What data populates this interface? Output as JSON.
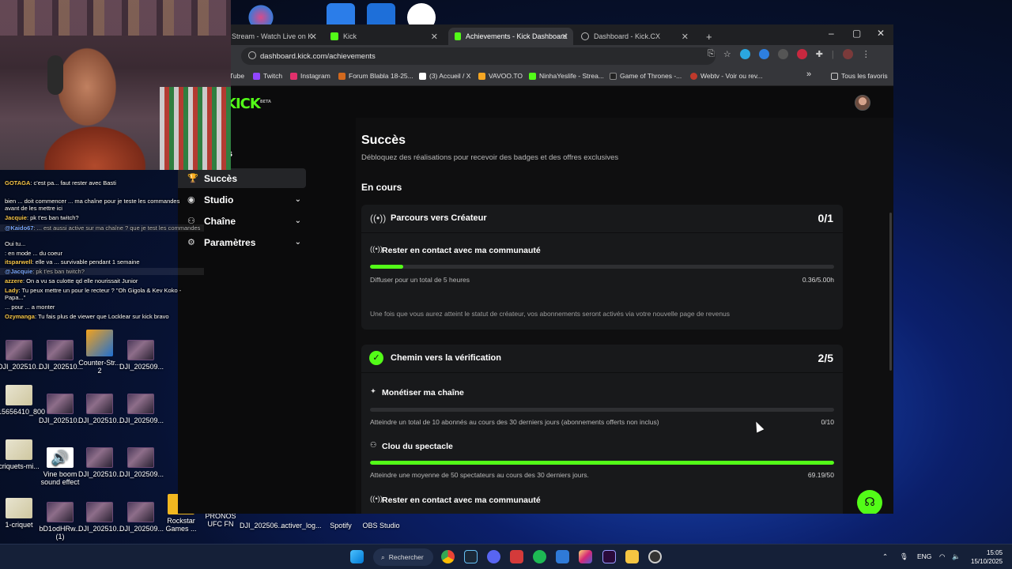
{
  "browser": {
    "tabs": [
      {
        "title": "Stream - Watch Live on K",
        "active": false
      },
      {
        "title": "Kick",
        "active": false
      },
      {
        "title": "Achievements - Kick Dashboard",
        "active": true
      },
      {
        "title": "Dashboard - Kick.CX",
        "active": false
      }
    ],
    "new_tab": "+",
    "url": "dashboard.kick.com/achievements",
    "bookmarks": [
      "Tube",
      "Twitch",
      "Instagram",
      "Forum Blabla 18-25...",
      "(3) Accueil / X",
      "VAVOO.TO",
      "NinhaYeslife - Strea...",
      "Game of Thrones -...",
      "Webtv - Voir ou rev..."
    ],
    "bookmarks_more": "»",
    "all_bookmarks": "Tous les favoris"
  },
  "kick": {
    "logo": "KICK",
    "logo_badge": "BETA",
    "sidebar": {
      "partial_items": [
        "n",
        "us"
      ],
      "items": [
        {
          "label": "Succès",
          "icon": "trophy-icon",
          "active": true,
          "expandable": false
        },
        {
          "label": "Studio",
          "icon": "studio-icon",
          "active": false,
          "expandable": true
        },
        {
          "label": "Chaîne",
          "icon": "channel-icon",
          "active": false,
          "expandable": true
        },
        {
          "label": "Paramètres",
          "icon": "settings-icon",
          "active": false,
          "expandable": true
        }
      ]
    },
    "main": {
      "title": "Succès",
      "subtitle": "Débloquez des réalisations pour recevoir des badges et des offres exclusives",
      "section": "En cours",
      "cards": [
        {
          "title": "Parcours vers Créateur",
          "count": "0/1",
          "tasks": [
            {
              "title": "Rester en contact avec ma communauté",
              "desc": "Diffuser pour un total de 5 heures",
              "value": "0.36/5.00h",
              "progress": 0.072
            }
          ],
          "note": "Une fois que vous aurez atteint le statut de créateur, vos abonnements seront activés via votre nouvelle page de revenus"
        },
        {
          "title": "Chemin vers la vérification",
          "count": "2/5",
          "tasks": [
            {
              "title": "Monétiser ma chaîne",
              "desc": "Atteindre un total de 10 abonnés au cours des 30 derniers jours (abonnements offerts non inclus)",
              "value": "0/10",
              "progress": 0
            },
            {
              "title": "Clou du spectacle",
              "desc": "Atteindre une moyenne de 50 spectateurs au cours des 30 derniers jours.",
              "value": "69.19/50",
              "progress": 1
            },
            {
              "title": "Rester en contact avec ma communauté"
            }
          ]
        }
      ]
    }
  },
  "chat": [
    {
      "user": "GOTAGA",
      "text": ": c'est pa... faut rester avec Basti"
    },
    {
      "user": "",
      "text": "bien ... doit commencer ... ma chaîne pour je teste les commandes avant de les mettre ici"
    },
    {
      "user": "Jacquie",
      "text": ": pk t'es ban twitch?"
    },
    {
      "user": "@Kaido67",
      "text": ": ... est aussi active sur ma chaîne ? que je test les commandes"
    },
    {
      "user": "",
      "text": "Oui tu..."
    },
    {
      "user": "",
      "text": ": en mode ... du coeur"
    },
    {
      "user": "itsparwell",
      "text": ": elle va ... survivable pendant 1 semaine"
    },
    {
      "user": "@Jacquie",
      "text": ": pk t'es ban twitch?"
    },
    {
      "user": "azzere",
      "text": ": On a vu sa culotte qd elle nourissait Junior"
    },
    {
      "user": "Lady",
      "text": ": Tu peux mettre un pour le recteur ? \"Oh Gigola & Kev Koko - Papa...\""
    },
    {
      "user": "",
      "text": "... pour ... a monter"
    },
    {
      "user": "Ozymanga",
      "text": ": Tu fais plus de viewer que Locklear sur kick bravo"
    }
  ],
  "desktop_icons": [
    {
      "label": "DJI_202510..."
    },
    {
      "label": "DJI_202510..."
    },
    {
      "label": "Counter-Str... 2"
    },
    {
      "label": "DJI_202509..."
    },
    {
      "label": "15656410_800"
    },
    {
      "label": "DJI_202510..."
    },
    {
      "label": "DJI_202510..."
    },
    {
      "label": "DJI_202509..."
    },
    {
      "label": "criquets-mi..."
    },
    {
      "label": "Vine boom sound effect"
    },
    {
      "label": "DJI_202510..."
    },
    {
      "label": "DJI_202509..."
    },
    {
      "label": "1-criquet"
    },
    {
      "label": "bD1odHRw... (1)"
    },
    {
      "label": "DJI_202510..."
    },
    {
      "label": "DJI_202509..."
    },
    {
      "label": "Rockstar Games ..."
    },
    {
      "label": "PRONOS UFC FN"
    },
    {
      "label": "DJI_202506..."
    },
    {
      "label": "activer_log..."
    },
    {
      "label": "Spotify"
    },
    {
      "label": "OBS Studio"
    }
  ],
  "taskbar": {
    "search": "Rechercher",
    "lang": "ENG",
    "time": "15:05",
    "date": "15/10/2025"
  }
}
